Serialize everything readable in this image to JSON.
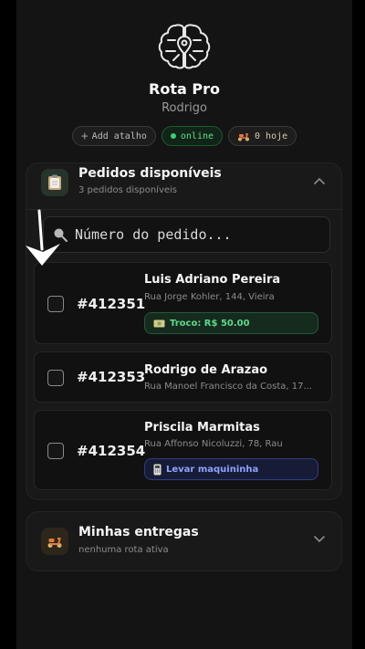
{
  "app": {
    "title": "Rota Pro",
    "user": "Rodrigo"
  },
  "chips": {
    "shortcut": "Add atalho",
    "status": "online",
    "today": "0 hoje"
  },
  "orders_panel": {
    "title": "Pedidos disponíveis",
    "subtitle": "3 pedidos disponíveis",
    "search_placeholder": "Número do pedido...",
    "orders": [
      {
        "number": "#412351",
        "customer": "Luis Adriano Pereira",
        "address": "Rua Jorge Kohler, 144, Vieira",
        "badge": "Troco: R$ 50.00"
      },
      {
        "number": "#412353",
        "customer": "Rodrigo de Arazao",
        "address": "Rua Manoel Francisco da Costa, 17...",
        "badge": ""
      },
      {
        "number": "#412354",
        "customer": "Priscila Marmitas",
        "address": "Rua Affonso Nicoluzzi, 78, Rau",
        "badge": "Levar maquininha"
      }
    ]
  },
  "deliveries_panel": {
    "title": "Minhas entregas",
    "subtitle": "nenhuma rota ativa"
  },
  "colors": {
    "accent_green": "#38d36f",
    "accent_blue": "#8ea2ff",
    "background": "#141414"
  },
  "icons": [
    "brain-map-logo-icon",
    "plus-icon",
    "online-dot-icon",
    "scooter-icon",
    "clipboard-icon",
    "chevron-up-icon",
    "search-icon",
    "cash-icon",
    "card-machine-icon",
    "chevron-down-icon"
  ]
}
